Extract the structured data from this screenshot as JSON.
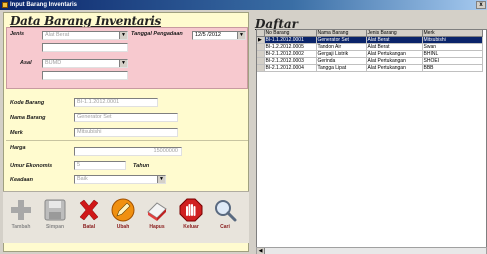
{
  "window": {
    "title": "Input Barang Inventaris",
    "close": "x"
  },
  "form": {
    "heading": "Data Barang Inventaris",
    "jenis": {
      "label": "Jenis",
      "value": "Alat Berat",
      "label_short": "Jenis"
    },
    "tanggal": {
      "label": "Tanggal Pengadaan",
      "value": "12/5 /2012"
    },
    "asal": {
      "label": "Asal",
      "value": "BUMD"
    },
    "kode": {
      "label": "Kode Barang",
      "value": "BI-1.1.2012.0001"
    },
    "nama": {
      "label": "Nama Barang",
      "value": "Generator Set"
    },
    "merk": {
      "label": "Merk",
      "value": "Mitsubishi"
    },
    "harga": {
      "label": "Harga",
      "value": "15000000"
    },
    "umur": {
      "label": "Umur Ekonomis",
      "value": "5",
      "unit": "Tahun"
    },
    "keadaan": {
      "label": "Keadaan",
      "value": "Baik"
    }
  },
  "toolbar": {
    "tambah": "Tambah",
    "simpan": "Simpan",
    "batal": "Batal",
    "ubah": "Ubah",
    "hapus": "Hapus",
    "keluar": "Keluar",
    "cari": "Cari"
  },
  "list": {
    "heading": "Daftar",
    "columns": [
      "No Barang",
      "Nama Barang",
      "Jenis Barang",
      "Merk"
    ],
    "rows": [
      [
        "BI-1.1.2012.0001",
        "Generator Set",
        "Alat Berat",
        "Mitsubishi"
      ],
      [
        "BI-1.2.2012.0005",
        "Tandon Air",
        "Alat Berat",
        "Swan"
      ],
      [
        "BI-2.1.2012.0002",
        "Gergaji Listrik",
        "Alat Pertukangan",
        "BHINL"
      ],
      [
        "BI-2.1.2012.0003",
        "Gerinda",
        "Alat Pertukangan",
        "SHOEI"
      ],
      [
        "BI-2.1.2012.0004",
        "Tangga Lipat",
        "Alat Pertukangan",
        "BBB"
      ]
    ],
    "selected_index": 0
  },
  "colors": {
    "selection": "#0a246a",
    "form_bg": "#fffbcf",
    "pink_bg": "#f7c9cf",
    "label_red": "#8b2020"
  }
}
